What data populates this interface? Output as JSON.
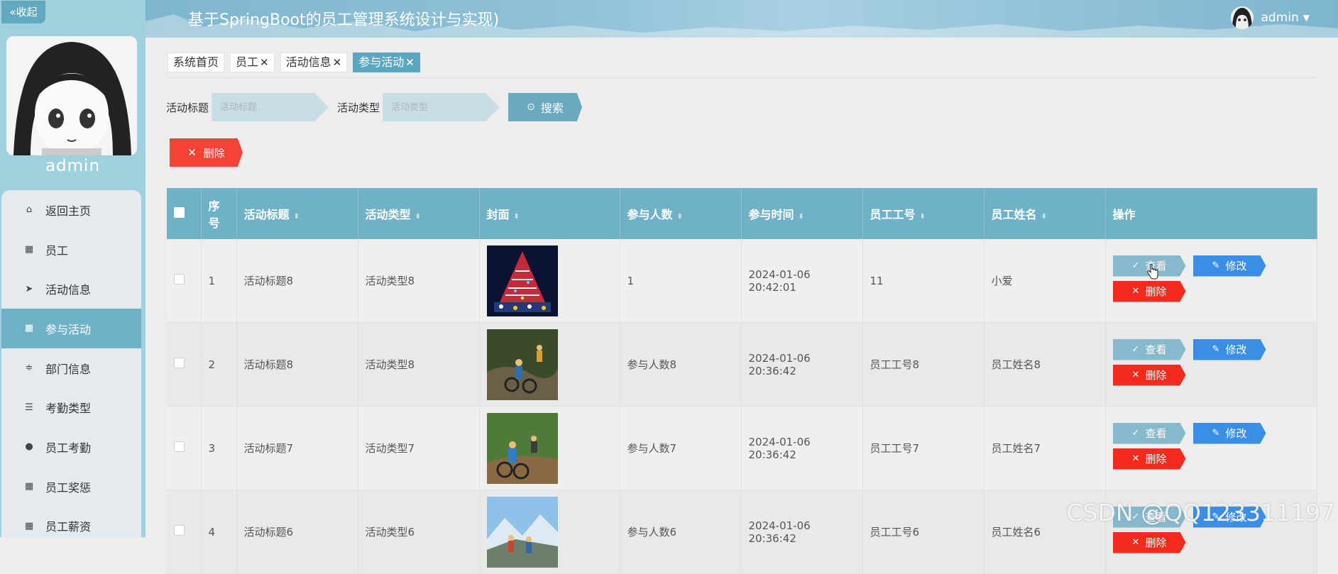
{
  "sidebar": {
    "collapse_label": "«收起",
    "username": "admin",
    "items": [
      {
        "label": "返回主页",
        "icon": "home-icon",
        "glyph": "⌂"
      },
      {
        "label": "员工",
        "icon": "grid-icon",
        "glyph": "▦"
      },
      {
        "label": "活动信息",
        "icon": "send-icon",
        "glyph": "➤"
      },
      {
        "label": "参与活动",
        "icon": "grid-icon",
        "glyph": "▦",
        "active": true
      },
      {
        "label": "部门信息",
        "icon": "sliders-icon",
        "glyph": "≑"
      },
      {
        "label": "考勤类型",
        "icon": "list-icon",
        "glyph": "☰"
      },
      {
        "label": "员工考勤",
        "icon": "user-icon",
        "glyph": "●"
      },
      {
        "label": "员工奖惩",
        "icon": "grid-icon",
        "glyph": "▦"
      },
      {
        "label": "员工薪资",
        "icon": "grid-icon",
        "glyph": "▦"
      }
    ]
  },
  "header": {
    "title": "基于SpringBoot的员工管理系统设计与实现)",
    "user": "admin"
  },
  "tabs": [
    {
      "label": "系统首页",
      "closable": false
    },
    {
      "label": "员工",
      "closable": true
    },
    {
      "label": "活动信息",
      "closable": true
    },
    {
      "label": "参与活动",
      "closable": true,
      "active": true
    }
  ],
  "search": {
    "title_label": "活动标题",
    "title_placeholder": "活动标题",
    "type_label": "活动类型",
    "type_placeholder": "活动类型",
    "button": "搜索"
  },
  "bulk_delete": "删除",
  "table": {
    "headers": [
      "序号",
      "活动标题",
      "活动类型",
      "封面",
      "参与人数",
      "参与时间",
      "员工工号",
      "员工姓名",
      "操作"
    ],
    "actions": {
      "view": "查看",
      "edit": "修改",
      "delete": "删除"
    },
    "rows": [
      {
        "no": "1",
        "title": "活动标题8",
        "type": "活动类型8",
        "cover": "christmas-tree",
        "count": "1",
        "time": "2024-01-06 20:42:01",
        "emp_no": "11",
        "emp_name": "小爱"
      },
      {
        "no": "2",
        "title": "活动标题8",
        "type": "活动类型8",
        "cover": "mountain-biking",
        "count": "参与人数8",
        "time": "2024-01-06 20:36:42",
        "emp_no": "员工工号8",
        "emp_name": "员工姓名8"
      },
      {
        "no": "3",
        "title": "活动标题7",
        "type": "活动类型7",
        "cover": "mountain-biking",
        "count": "参与人数7",
        "time": "2024-01-06 20:36:42",
        "emp_no": "员工工号7",
        "emp_name": "员工姓名7"
      },
      {
        "no": "4",
        "title": "活动标题6",
        "type": "活动类型6",
        "cover": "hiking",
        "count": "参与人数6",
        "time": "2024-01-06 20:36:42",
        "emp_no": "员工工号6",
        "emp_name": "员工姓名6"
      }
    ]
  },
  "watermark": "CSDN @QQ123311197",
  "colors": {
    "primary": "#6fb2c8",
    "danger": "#f44336",
    "edit": "#3a8ee6",
    "sidebar": "#9ed0dd"
  }
}
